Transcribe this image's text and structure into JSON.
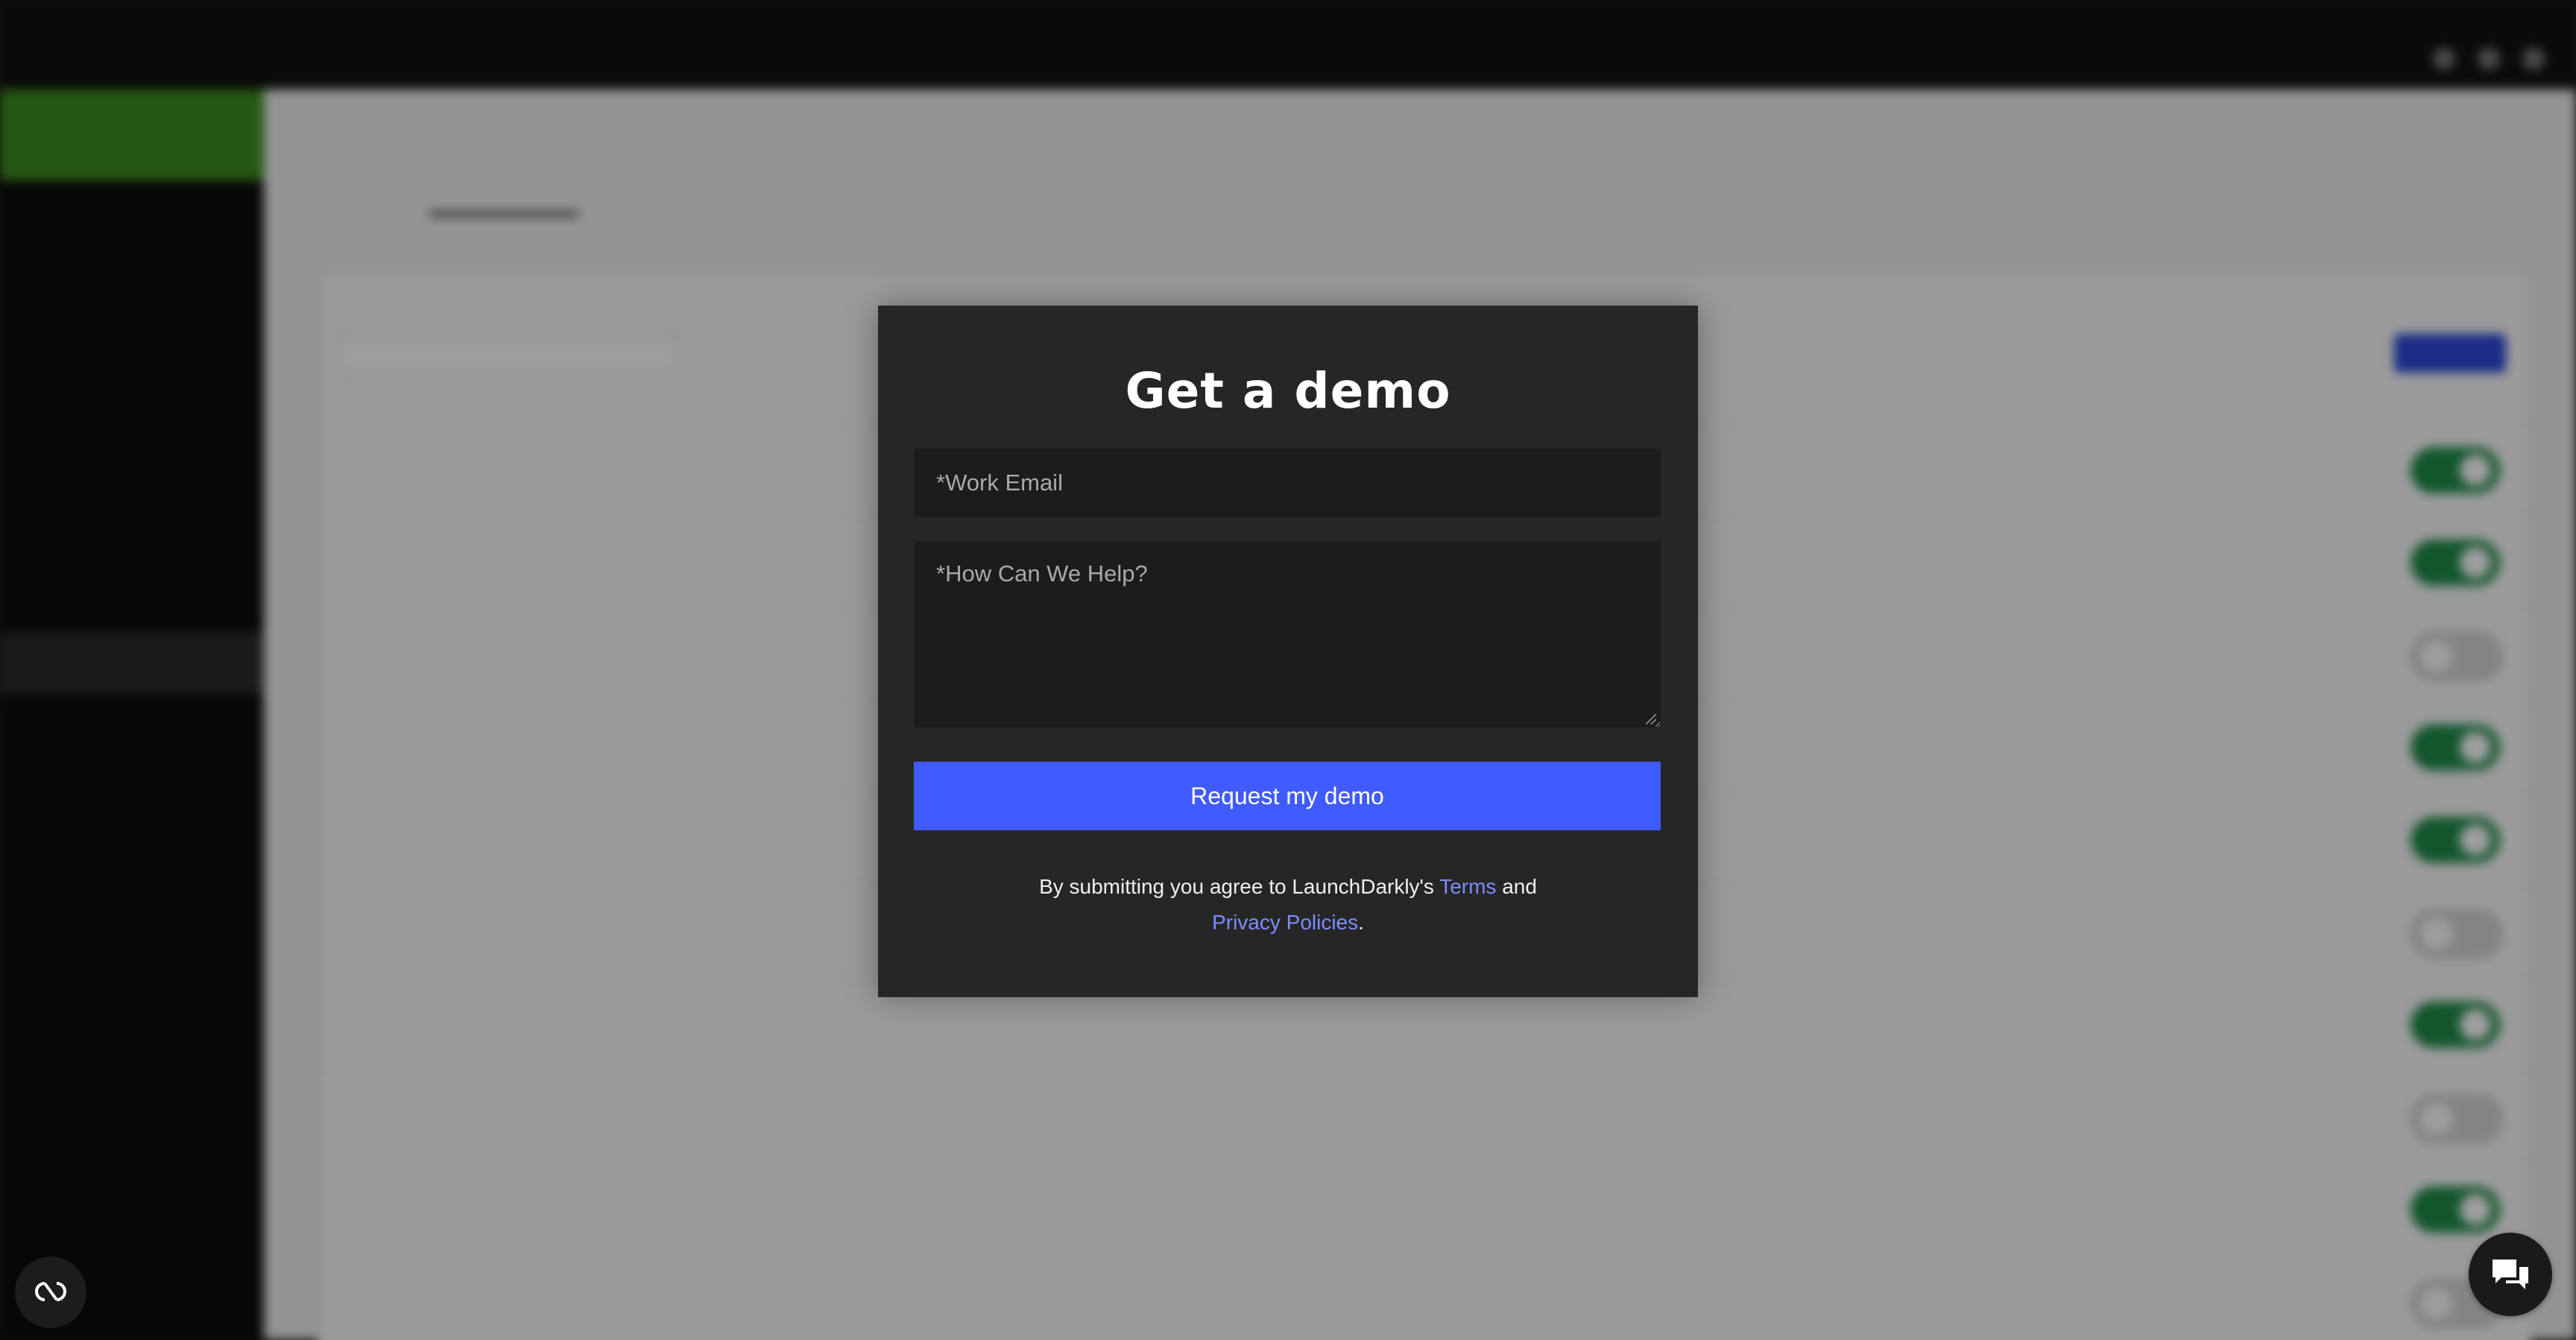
{
  "modal": {
    "title": "Get a demo",
    "email_placeholder": "*Work Email",
    "help_placeholder": "*How Can We Help?",
    "submit_label": "Request my demo",
    "legal_prefix": "By submitting you agree to LaunchDarkly's ",
    "terms_link": "Terms",
    "legal_and": " and",
    "privacy_link": "Privacy Policies",
    "legal_suffix": "."
  },
  "floating": {
    "cookie_icon": "cookie-settings-icon",
    "chat_icon": "chat-bubbles-icon"
  },
  "colors": {
    "modal_bg": "#262626",
    "accent": "#405bff",
    "link": "#7d8cff",
    "toggle_on": "#1f8c4a"
  }
}
